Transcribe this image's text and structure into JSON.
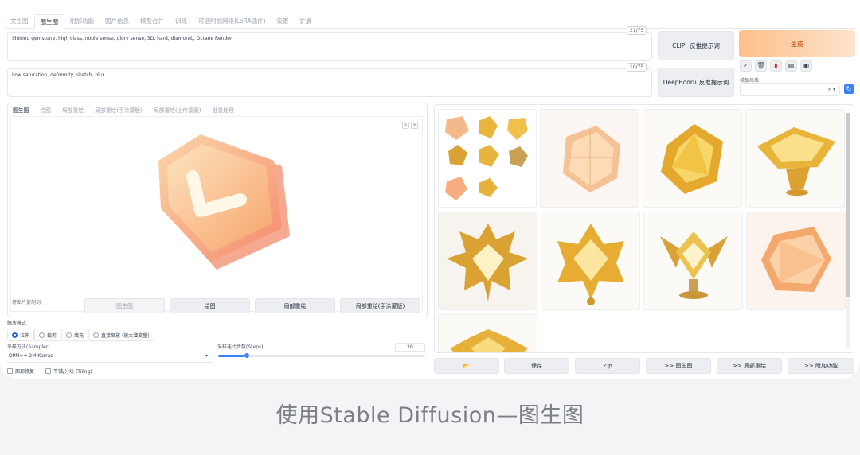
{
  "top_tabs": [
    "文生图",
    "图生图",
    "附加功能",
    "图片信息",
    "模型合并",
    "训练",
    "可选附加网络(LoRA插件)",
    "设置",
    "扩展"
  ],
  "active_tab_index": 1,
  "prompt": {
    "positive": "Shining gemstone, high class, noble sense, glory sense, 3D, hard, diamond,,  Octane Render",
    "positive_count": "21/75",
    "negative": "Low saturation, deformity, sketch, blur",
    "negative_count": "10/75"
  },
  "interrogate": {
    "clip_label": "CLIP",
    "clip_action": "反推提示词",
    "deepbooru_label": "DeepBooru",
    "deepbooru_action": "反推提示词"
  },
  "generate_label": "生成",
  "tool_icons": [
    "check-icon",
    "trash-icon",
    "red-card-icon",
    "clipboard-icon",
    "save-style-icon"
  ],
  "template": {
    "label": "模板风格",
    "value": "× ▾"
  },
  "sub_tabs": [
    "图生图",
    "绘图",
    "局部重绘",
    "局部重绘(手涂蒙版)",
    "局部重绘(上传蒙版)",
    "批量处理"
  ],
  "copy_to": {
    "label": "将图片复制到:",
    "buttons": [
      "图生图",
      "绘图",
      "局部重绘",
      "局部重绘(手涂蒙版)"
    ]
  },
  "resize": {
    "label": "缩放模式",
    "options": [
      "拉伸",
      "裁剪",
      "填充",
      "直接缩放 (放大潜变量)"
    ],
    "selected": 0
  },
  "sampler": {
    "label": "采样方法(Sampler)",
    "value": "DPM++ 2M Karras"
  },
  "steps": {
    "label": "采样迭代步数(Steps)",
    "value": "20",
    "fraction": 0.14
  },
  "checkboxes": [
    "面部修复",
    "平铺/分块 (Tiling)"
  ],
  "gallery_buttons": [
    "📂",
    "保存",
    "Zip",
    ">> 图生图",
    ">> 局部重绘",
    ">> 附加功能"
  ],
  "caption": "使用Stable Diffusion—图生图",
  "colors": {
    "accent": "#3b82f6",
    "generate_start": "#fdc08a",
    "generate_end": "#fde3cc",
    "gold": "#e8b23a",
    "peach": "#f7a77a"
  }
}
